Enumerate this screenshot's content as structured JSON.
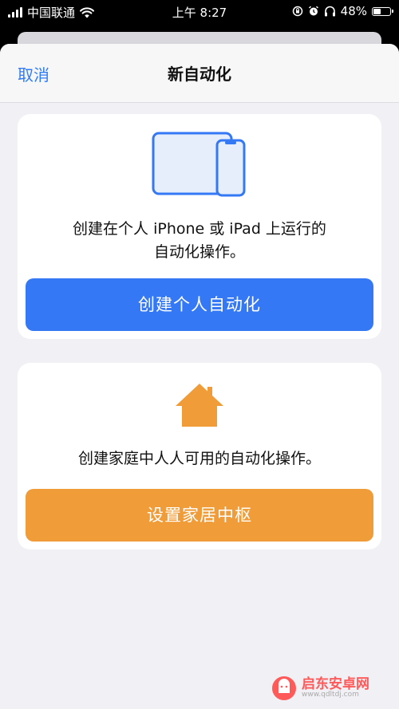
{
  "status_bar": {
    "carrier": "中国联通",
    "time": "上午 8:27",
    "battery_percent": "48%",
    "battery_level": 0.48
  },
  "nav": {
    "cancel_label": "取消",
    "title": "新自动化"
  },
  "personal_card": {
    "icon": "iphone-ipad-icon",
    "description_line1": "创建在个人 iPhone 或 iPad 上运行的",
    "description_line2": "自动化操作。",
    "button_label": "创建个人自动化",
    "accent_color": "#3478f6"
  },
  "home_card": {
    "icon": "house-icon",
    "description": "创建家庭中人人可用的自动化操作。",
    "button_label": "设置家居中枢",
    "accent_color": "#f09c38"
  },
  "watermark": {
    "name": "启东安卓网",
    "url": "www.qdltdj.com"
  }
}
